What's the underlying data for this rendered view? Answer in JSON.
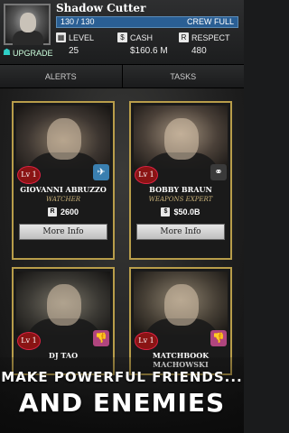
{
  "player": {
    "name": "Shadow Cutter",
    "upgrade_label": "UPGRADE",
    "crew_count": "130 / 130",
    "crew_status": "CREW FULL",
    "crew_fill": 1.0
  },
  "stats": {
    "level_label": "LEVEL",
    "level_value": "25",
    "cash_label": "CASH",
    "cash_value": "$160.6 M",
    "respect_label": "RESPECT",
    "respect_value": "480"
  },
  "tabs": {
    "alerts": "ALERTS",
    "tasks": "TASKS"
  },
  "cards": [
    {
      "level": "Lv 1",
      "name": "GIOVANNI ABRUZZO",
      "role": "WATCHER",
      "price": "2600",
      "currency_icon": "R",
      "type_icon_color": "#3a7fb0",
      "type_icon_glyph": "✈",
      "button": "More Info"
    },
    {
      "level": "Lv 1",
      "name": "BOBBY BRAUN",
      "role": "WEAPONS EXPERT",
      "price": "$50.0B",
      "currency_icon": "$",
      "type_icon_color": "#3a3a3a",
      "type_icon_glyph": "⚭",
      "button": "More Info"
    },
    {
      "level": "Lv 1",
      "name": "DJ TAO",
      "role": "",
      "type_icon_color": "#b0457e",
      "type_icon_glyph": "👎"
    },
    {
      "level": "Lv 1",
      "name": "MATCHBOOK MACHOWSKI",
      "role": "",
      "type_icon_color": "#b0457e",
      "type_icon_glyph": "👎"
    }
  ],
  "banner": {
    "line1": "MAKE POWERFUL FRIENDS...",
    "line2": "AND ENEMIES"
  }
}
